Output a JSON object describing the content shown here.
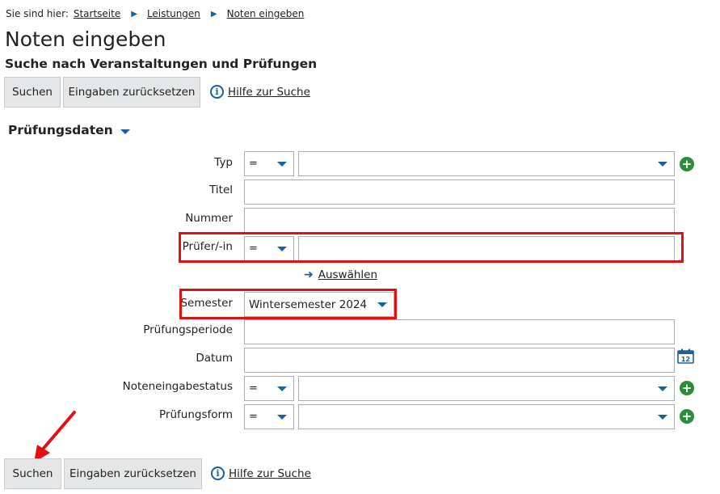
{
  "breadcrumb": {
    "lead": "Sie sind hier:",
    "items": [
      "Startseite",
      "Leistungen",
      "Noten eingeben"
    ]
  },
  "page": {
    "title": "Noten eingeben",
    "subtitle": "Suche nach Veranstaltungen und Prüfungen"
  },
  "toolbar": {
    "search_label": "Suchen",
    "reset_label": "Eingaben zurücksetzen",
    "help_label": "Hilfe zur Suche"
  },
  "section": {
    "title": "Prüfungsdaten"
  },
  "fields": {
    "typ": {
      "label": "Typ",
      "operator": "=",
      "value": ""
    },
    "titel": {
      "label": "Titel",
      "value": ""
    },
    "nummer": {
      "label": "Nummer",
      "value": ""
    },
    "pruefer": {
      "label": "Prüfer/-in",
      "operator": "=",
      "value": "",
      "select_link": "Auswählen"
    },
    "semester": {
      "label": "Semester",
      "value": "Wintersemester 2024"
    },
    "pruefungsperiode": {
      "label": "Prüfungsperiode",
      "value": ""
    },
    "datum": {
      "label": "Datum",
      "value": "",
      "calendar_day": "12"
    },
    "noteneingabestatus": {
      "label": "Noteneingabestatus",
      "operator": "=",
      "value": ""
    },
    "pruefungsform": {
      "label": "Prüfungsform",
      "operator": "=",
      "value": ""
    }
  },
  "icons": {
    "add": "plus-circle-icon",
    "info": "info-icon",
    "calendar": "calendar-icon",
    "chevron": "chevron-right-icon"
  },
  "colors": {
    "accent": "#1a5fa0",
    "add": "#2e8b3a",
    "highlight": "#e01010",
    "button_bg": "#e4e6e7"
  }
}
